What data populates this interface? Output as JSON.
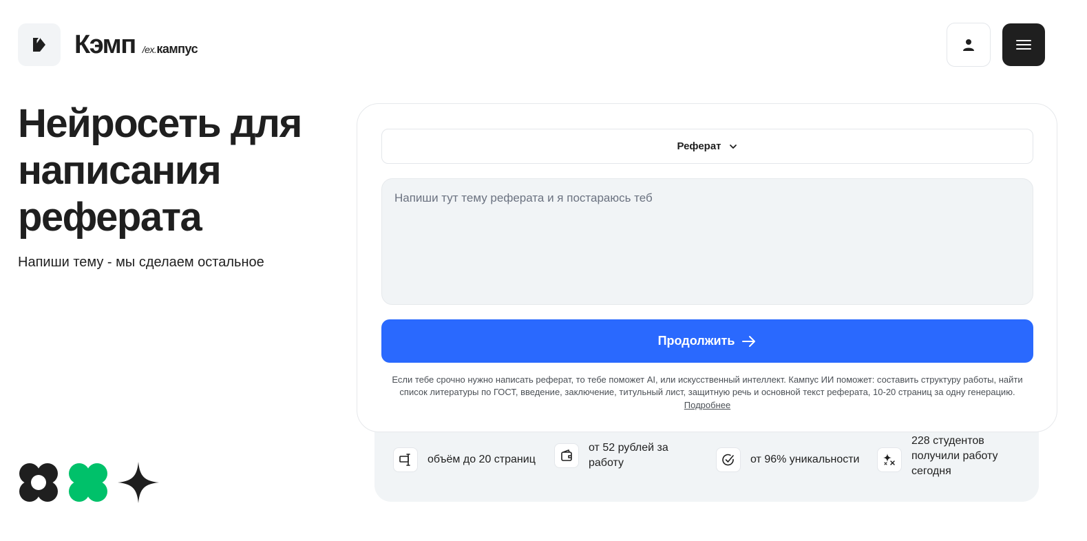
{
  "header": {
    "brand_name": "Кэмп",
    "brand_sub_ex": "/ex.",
    "brand_sub_name": "кампус",
    "logo_icon": "k-logo-icon",
    "user_icon": "user-icon",
    "menu_icon": "hamburger-menu-icon"
  },
  "hero": {
    "title": "Нейросеть для написания реферата",
    "subtitle": "Напиши тему - мы сделаем остальное"
  },
  "form": {
    "work_type": "Реферат",
    "topic_placeholder": "Напиши тут тему реферата и я постараюсь теб",
    "topic_value": "",
    "continue_label": "Продолжить",
    "note": "Если тебе срочно нужно написать реферат, то тебе поможет AI, или искусственный интеллект. Кампус ИИ поможет: составить структуру работы, найти список литературы по ГОСТ, введение, заключение, титульный лист, защитную речь и основной текст реферата, 10-20 страниц за одну генерацию.",
    "more_link": "Подробнее"
  },
  "features": [
    {
      "icon": "text-cursor-icon",
      "text": "объём до 20 страниц"
    },
    {
      "icon": "wallet-icon",
      "text": "от 52 рублей за работу"
    },
    {
      "icon": "check-circle-icon",
      "text": "от 96% уникальности"
    },
    {
      "icon": "sparkles-icon",
      "text": "228 студентов получили работу сегодня"
    }
  ],
  "colors": {
    "accent": "#2a69fe",
    "dark": "#1f1f1f",
    "green": "#00c16a",
    "surface": "#f1f4f6"
  }
}
